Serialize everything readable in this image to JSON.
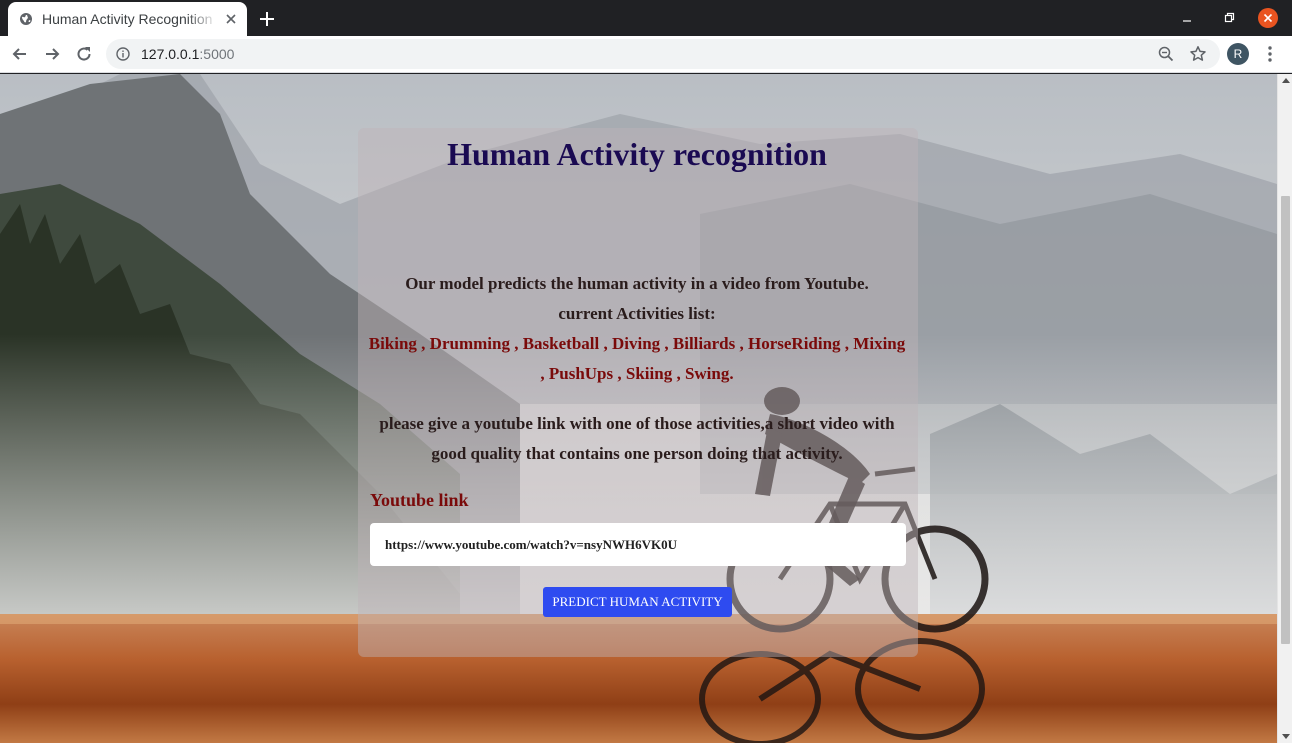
{
  "browser": {
    "tab_title": "Human Activity Recognition",
    "url_host": "127.0.0.1",
    "url_port": ":5000",
    "profile_initial": "R"
  },
  "icons": {
    "favicon": "globe-icon",
    "tab_close": "close-icon",
    "new_tab": "plus-icon",
    "back": "arrow-left-icon",
    "forward": "arrow-right-icon",
    "reload": "reload-icon",
    "site_info": "info-icon",
    "zoom": "zoom-out-icon",
    "bookmark": "star-icon",
    "menu": "kebab-icon"
  },
  "colors": {
    "title": "#1a0a52",
    "activities": "#7a0a0a",
    "button": "#2e4bf0",
    "window_close": "#e95420"
  },
  "page": {
    "title": "Human Activity recognition",
    "description": "Our model predicts the human activity in a video from Youtube.",
    "activities_label": "current Activities list:",
    "activities": "Biking , Drumming , Basketball , Diving , Billiards , HorseRiding , Mixing , PushUps , Skiing , Swing.",
    "instructions": "please give a youtube link with one of those activities,a short video with good quality that contains one person doing that activity.",
    "link_label": "Youtube link",
    "link_value": "https://www.youtube.com/watch?v=nsyNWH6VK0U",
    "submit_label": "PREDICT HUMAN ACTIVITY"
  }
}
